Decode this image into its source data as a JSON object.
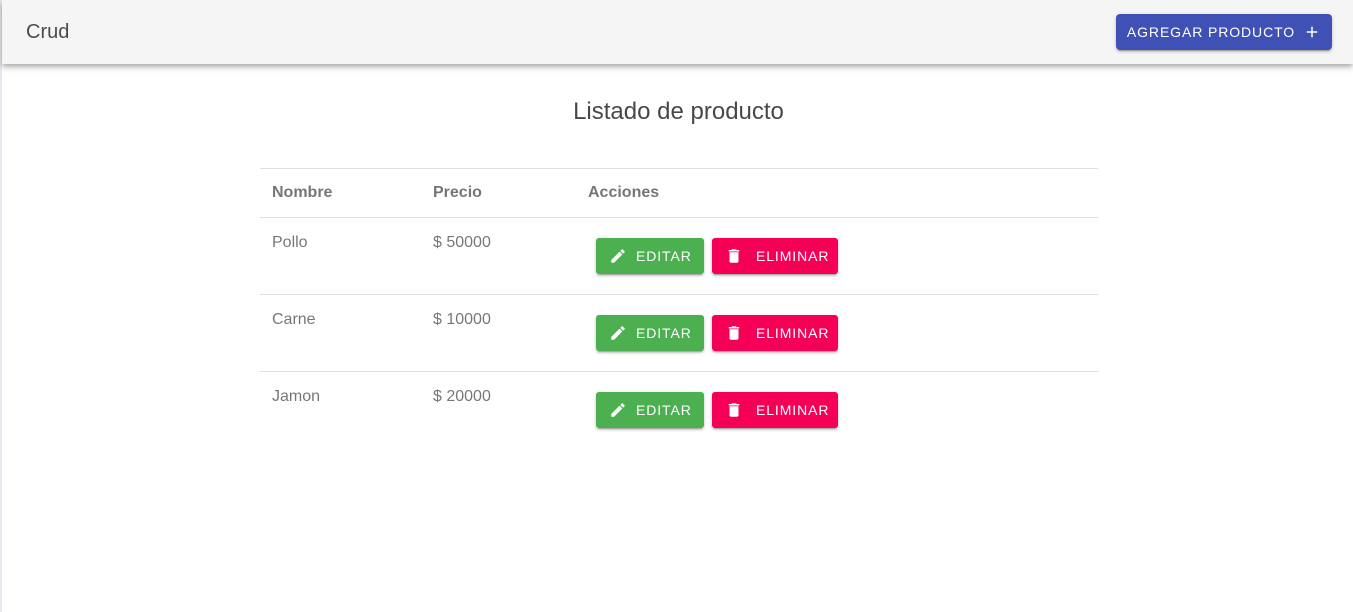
{
  "app": {
    "title": "Crud",
    "add_button_label": "Agregar producto"
  },
  "page": {
    "title": "Listado de producto"
  },
  "table": {
    "columns": [
      "Nombre",
      "Precio",
      "Acciones"
    ],
    "rows": [
      {
        "nombre": "Pollo",
        "precio": "$ 50000",
        "edit_label": "Editar",
        "delete_label": "Eliminar"
      },
      {
        "nombre": "Carne",
        "precio": "$ 10000",
        "edit_label": "Editar",
        "delete_label": "Eliminar"
      },
      {
        "nombre": "Jamon",
        "precio": "$ 20000",
        "edit_label": "Editar",
        "delete_label": "Eliminar"
      }
    ]
  },
  "icons": {
    "add": "plus-icon",
    "edit": "pencil-icon",
    "delete": "trash-icon"
  },
  "colors": {
    "primary": "#3f51b5",
    "edit": "#4caf50",
    "delete": "#f50057",
    "toolbar": "#f5f5f5"
  }
}
